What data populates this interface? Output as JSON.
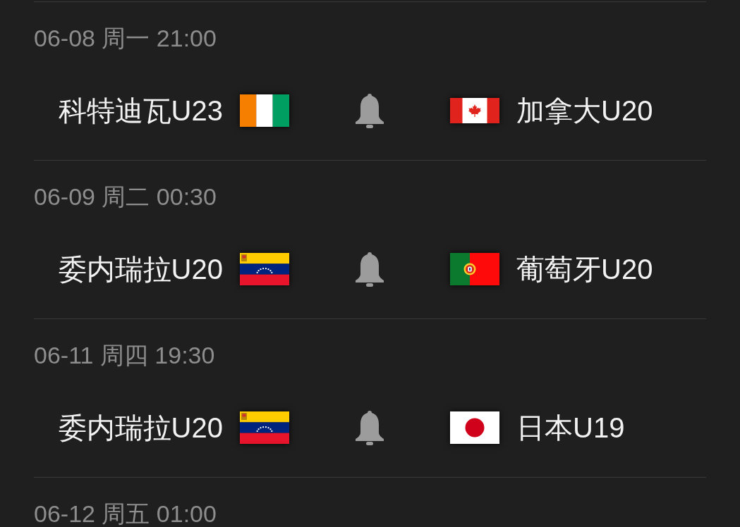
{
  "matches": [
    {
      "datetime": "06-08 周一 21:00",
      "home": {
        "name": "科特迪瓦U23",
        "kind": "ci"
      },
      "away": {
        "name": "加拿大U20",
        "kind": "ca"
      }
    },
    {
      "datetime": "06-09 周二 00:30",
      "home": {
        "name": "委内瑞拉U20",
        "kind": "ve"
      },
      "away": {
        "name": "葡萄牙U20",
        "kind": "pt"
      }
    },
    {
      "datetime": "06-11 周四 19:30",
      "home": {
        "name": "委内瑞拉U20",
        "kind": "ve"
      },
      "away": {
        "name": "日本U19",
        "kind": "jp"
      }
    },
    {
      "datetime": "06-12 周五 01:00"
    }
  ]
}
